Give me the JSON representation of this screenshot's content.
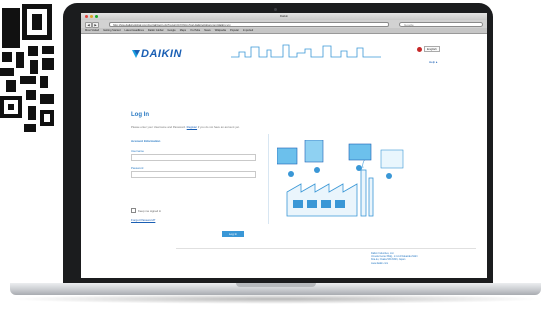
{
  "browser": {
    "window_title": "Daikin",
    "nav_back": "◀",
    "nav_forward": "▶",
    "url": "http://ww.daikinglobal.com/portal/login.do?returnUrl=http://ssl.daikinglobal.com/daikin-vrv",
    "search_placeholder": "Google",
    "bookmarks": [
      "Most Visited",
      "Getting Started",
      "Latest Headlines",
      "Daikin Global",
      "Google",
      "Maps",
      "YouTube",
      "News",
      "Wikipedia",
      "Popular",
      "Imported"
    ]
  },
  "header": {
    "brand": "DAIKIN",
    "language": "English",
    "help": "Help ▸"
  },
  "login": {
    "title": "Log In",
    "intro_before": "Please enter your Username and Password.",
    "intro_link": "Register",
    "intro_after": "if you do not have an account yet.",
    "section": "Account Information",
    "username_label": "Username",
    "username_value": "",
    "password_label": "Password",
    "password_value": "",
    "remember": "Keep me signed in",
    "forgot": "Forgot Password?",
    "submit": "Log In"
  },
  "footer": {
    "company": "Daikin Industries, Ltd.",
    "line1": "Umeda Center Bldg., 2-4-12 Nakazaki-Nishi",
    "line2": "Kita-ku, Osaka 530-8323, Japan",
    "line3": "www.daikin.com"
  },
  "colors": {
    "brand_blue": "#1a5fb4",
    "accent_blue": "#2b7bc4",
    "button_blue": "#3a97d6"
  },
  "icons": [
    "qr-code",
    "daikin-logo-icon",
    "city-skyline-icon",
    "flag-icon",
    "building-illustration-icon"
  ]
}
